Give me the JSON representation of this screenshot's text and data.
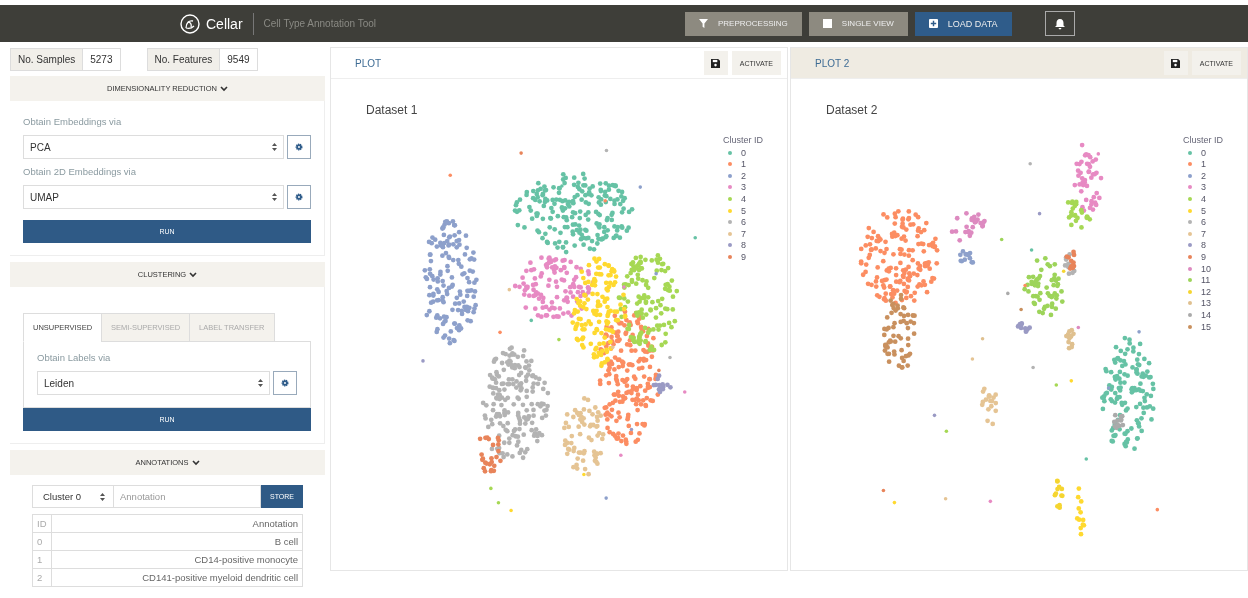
{
  "topbar": {
    "app_name": "Cellar",
    "subtitle": "Cell Type Annotation Tool",
    "buttons": [
      {
        "label": "PREPROCESSING",
        "kind": "filter"
      },
      {
        "label": "SINGLE VIEW",
        "kind": "square"
      },
      {
        "label": "LOAD DATA",
        "kind": "plus"
      }
    ]
  },
  "stats": [
    {
      "label": "No. Samples",
      "value": "5273"
    },
    {
      "label": "No. Features",
      "value": "9549"
    }
  ],
  "dimensionality_reduction": {
    "title": "DIMENSIONALITY REDUCTION",
    "fields": [
      {
        "label": "Obtain Embeddings via",
        "value": "PCA"
      },
      {
        "label": "Obtain 2D Embeddings via",
        "value": "UMAP"
      }
    ],
    "run": "RUN"
  },
  "clustering": {
    "title": "CLUSTERING",
    "tabs": [
      {
        "label": "UNSUPERVISED",
        "selected": true
      },
      {
        "label": "SEMI-SUPERVISED",
        "selected": false
      },
      {
        "label": "LABEL TRANSFER",
        "selected": false
      }
    ],
    "field": {
      "label": "Obtain Labels via",
      "value": "Leiden"
    },
    "run": "RUN"
  },
  "annotations": {
    "title": "ANNOTATIONS",
    "cluster": "Cluster 0",
    "placeholder": "Annotation",
    "store": "STORE",
    "columns": [
      "ID",
      "Annotation"
    ],
    "rows": [
      [
        "0",
        "B cell"
      ],
      [
        "1",
        "CD14-positive monocyte"
      ],
      [
        "2",
        "CD141-positive myeloid dendritic cell"
      ]
    ]
  },
  "plots": [
    {
      "title": "PLOT",
      "selected": true,
      "activate": "ACTIVATE",
      "dataset": "Dataset 1",
      "legend_title": "Cluster ID",
      "legend": [
        {
          "label": "0",
          "color": "#66c2a5"
        },
        {
          "label": "1",
          "color": "#fc8d62"
        },
        {
          "label": "2",
          "color": "#8da0cb"
        },
        {
          "label": "3",
          "color": "#e78ac3"
        },
        {
          "label": "4",
          "color": "#a6d854"
        },
        {
          "label": "5",
          "color": "#ffd92f"
        },
        {
          "label": "6",
          "color": "#b3b3b3"
        },
        {
          "label": "7",
          "color": "#e5c494"
        },
        {
          "label": "8",
          "color": "#9a9ac4"
        },
        {
          "label": "9",
          "color": "#e8845a"
        }
      ]
    },
    {
      "title": "PLOT 2",
      "selected": false,
      "activate": "ACTIVATE",
      "dataset": "Dataset 2",
      "legend_title": "Cluster ID",
      "legend": [
        {
          "label": "0",
          "color": "#66c2a5"
        },
        {
          "label": "1",
          "color": "#fc8d62"
        },
        {
          "label": "2",
          "color": "#8da0cb"
        },
        {
          "label": "3",
          "color": "#e78ac3"
        },
        {
          "label": "4",
          "color": "#a6d854"
        },
        {
          "label": "5",
          "color": "#ffd92f"
        },
        {
          "label": "6",
          "color": "#b3b3b3"
        },
        {
          "label": "7",
          "color": "#e5c494"
        },
        {
          "label": "8",
          "color": "#9a9ac4"
        },
        {
          "label": "9",
          "color": "#e8845a"
        },
        {
          "label": "10",
          "color": "#dd8ac0"
        },
        {
          "label": "11",
          "color": "#9dd45a"
        },
        {
          "label": "12",
          "color": "#f5d530"
        },
        {
          "label": "13",
          "color": "#dfc08f"
        },
        {
          "label": "14",
          "color": "#aaaaaa"
        },
        {
          "label": "15",
          "color": "#c9905e"
        }
      ]
    }
  ]
}
